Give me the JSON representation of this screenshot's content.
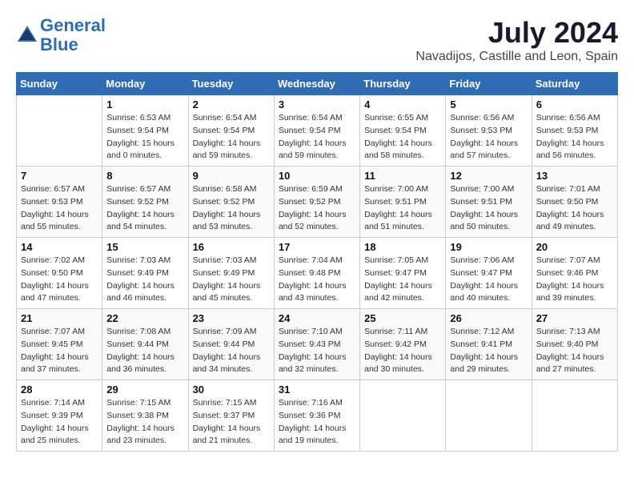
{
  "logo": {
    "line1": "General",
    "line2": "Blue"
  },
  "title": {
    "month_year": "July 2024",
    "location": "Navadijos, Castille and Leon, Spain"
  },
  "days_of_week": [
    "Sunday",
    "Monday",
    "Tuesday",
    "Wednesday",
    "Thursday",
    "Friday",
    "Saturday"
  ],
  "weeks": [
    [
      {
        "day": "",
        "info": ""
      },
      {
        "day": "1",
        "sunrise": "Sunrise: 6:53 AM",
        "sunset": "Sunset: 9:54 PM",
        "daylight": "Daylight: 15 hours and 0 minutes."
      },
      {
        "day": "2",
        "sunrise": "Sunrise: 6:54 AM",
        "sunset": "Sunset: 9:54 PM",
        "daylight": "Daylight: 14 hours and 59 minutes."
      },
      {
        "day": "3",
        "sunrise": "Sunrise: 6:54 AM",
        "sunset": "Sunset: 9:54 PM",
        "daylight": "Daylight: 14 hours and 59 minutes."
      },
      {
        "day": "4",
        "sunrise": "Sunrise: 6:55 AM",
        "sunset": "Sunset: 9:54 PM",
        "daylight": "Daylight: 14 hours and 58 minutes."
      },
      {
        "day": "5",
        "sunrise": "Sunrise: 6:56 AM",
        "sunset": "Sunset: 9:53 PM",
        "daylight": "Daylight: 14 hours and 57 minutes."
      },
      {
        "day": "6",
        "sunrise": "Sunrise: 6:56 AM",
        "sunset": "Sunset: 9:53 PM",
        "daylight": "Daylight: 14 hours and 56 minutes."
      }
    ],
    [
      {
        "day": "7",
        "sunrise": "Sunrise: 6:57 AM",
        "sunset": "Sunset: 9:53 PM",
        "daylight": "Daylight: 14 hours and 55 minutes."
      },
      {
        "day": "8",
        "sunrise": "Sunrise: 6:57 AM",
        "sunset": "Sunset: 9:52 PM",
        "daylight": "Daylight: 14 hours and 54 minutes."
      },
      {
        "day": "9",
        "sunrise": "Sunrise: 6:58 AM",
        "sunset": "Sunset: 9:52 PM",
        "daylight": "Daylight: 14 hours and 53 minutes."
      },
      {
        "day": "10",
        "sunrise": "Sunrise: 6:59 AM",
        "sunset": "Sunset: 9:52 PM",
        "daylight": "Daylight: 14 hours and 52 minutes."
      },
      {
        "day": "11",
        "sunrise": "Sunrise: 7:00 AM",
        "sunset": "Sunset: 9:51 PM",
        "daylight": "Daylight: 14 hours and 51 minutes."
      },
      {
        "day": "12",
        "sunrise": "Sunrise: 7:00 AM",
        "sunset": "Sunset: 9:51 PM",
        "daylight": "Daylight: 14 hours and 50 minutes."
      },
      {
        "day": "13",
        "sunrise": "Sunrise: 7:01 AM",
        "sunset": "Sunset: 9:50 PM",
        "daylight": "Daylight: 14 hours and 49 minutes."
      }
    ],
    [
      {
        "day": "14",
        "sunrise": "Sunrise: 7:02 AM",
        "sunset": "Sunset: 9:50 PM",
        "daylight": "Daylight: 14 hours and 47 minutes."
      },
      {
        "day": "15",
        "sunrise": "Sunrise: 7:03 AM",
        "sunset": "Sunset: 9:49 PM",
        "daylight": "Daylight: 14 hours and 46 minutes."
      },
      {
        "day": "16",
        "sunrise": "Sunrise: 7:03 AM",
        "sunset": "Sunset: 9:49 PM",
        "daylight": "Daylight: 14 hours and 45 minutes."
      },
      {
        "day": "17",
        "sunrise": "Sunrise: 7:04 AM",
        "sunset": "Sunset: 9:48 PM",
        "daylight": "Daylight: 14 hours and 43 minutes."
      },
      {
        "day": "18",
        "sunrise": "Sunrise: 7:05 AM",
        "sunset": "Sunset: 9:47 PM",
        "daylight": "Daylight: 14 hours and 42 minutes."
      },
      {
        "day": "19",
        "sunrise": "Sunrise: 7:06 AM",
        "sunset": "Sunset: 9:47 PM",
        "daylight": "Daylight: 14 hours and 40 minutes."
      },
      {
        "day": "20",
        "sunrise": "Sunrise: 7:07 AM",
        "sunset": "Sunset: 9:46 PM",
        "daylight": "Daylight: 14 hours and 39 minutes."
      }
    ],
    [
      {
        "day": "21",
        "sunrise": "Sunrise: 7:07 AM",
        "sunset": "Sunset: 9:45 PM",
        "daylight": "Daylight: 14 hours and 37 minutes."
      },
      {
        "day": "22",
        "sunrise": "Sunrise: 7:08 AM",
        "sunset": "Sunset: 9:44 PM",
        "daylight": "Daylight: 14 hours and 36 minutes."
      },
      {
        "day": "23",
        "sunrise": "Sunrise: 7:09 AM",
        "sunset": "Sunset: 9:44 PM",
        "daylight": "Daylight: 14 hours and 34 minutes."
      },
      {
        "day": "24",
        "sunrise": "Sunrise: 7:10 AM",
        "sunset": "Sunset: 9:43 PM",
        "daylight": "Daylight: 14 hours and 32 minutes."
      },
      {
        "day": "25",
        "sunrise": "Sunrise: 7:11 AM",
        "sunset": "Sunset: 9:42 PM",
        "daylight": "Daylight: 14 hours and 30 minutes."
      },
      {
        "day": "26",
        "sunrise": "Sunrise: 7:12 AM",
        "sunset": "Sunset: 9:41 PM",
        "daylight": "Daylight: 14 hours and 29 minutes."
      },
      {
        "day": "27",
        "sunrise": "Sunrise: 7:13 AM",
        "sunset": "Sunset: 9:40 PM",
        "daylight": "Daylight: 14 hours and 27 minutes."
      }
    ],
    [
      {
        "day": "28",
        "sunrise": "Sunrise: 7:14 AM",
        "sunset": "Sunset: 9:39 PM",
        "daylight": "Daylight: 14 hours and 25 minutes."
      },
      {
        "day": "29",
        "sunrise": "Sunrise: 7:15 AM",
        "sunset": "Sunset: 9:38 PM",
        "daylight": "Daylight: 14 hours and 23 minutes."
      },
      {
        "day": "30",
        "sunrise": "Sunrise: 7:15 AM",
        "sunset": "Sunset: 9:37 PM",
        "daylight": "Daylight: 14 hours and 21 minutes."
      },
      {
        "day": "31",
        "sunrise": "Sunrise: 7:16 AM",
        "sunset": "Sunset: 9:36 PM",
        "daylight": "Daylight: 14 hours and 19 minutes."
      },
      {
        "day": "",
        "info": ""
      },
      {
        "day": "",
        "info": ""
      },
      {
        "day": "",
        "info": ""
      }
    ]
  ]
}
